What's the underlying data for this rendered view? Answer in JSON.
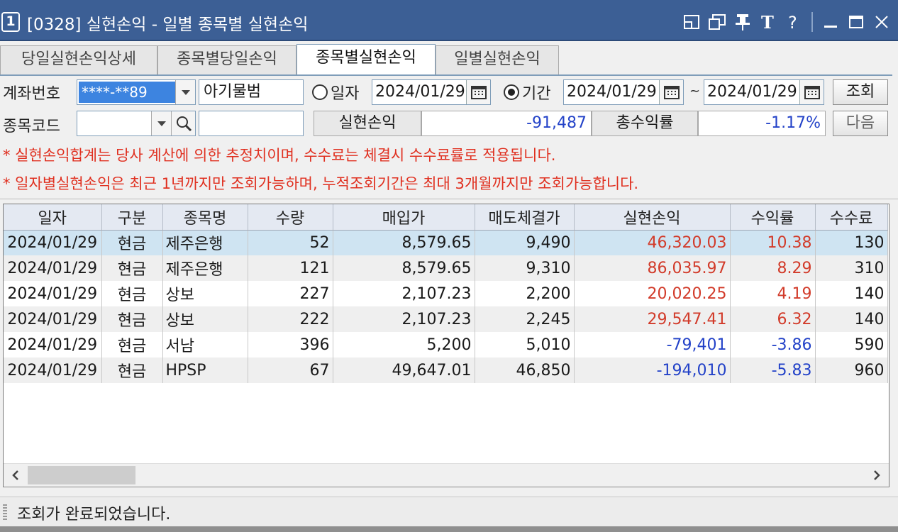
{
  "window": {
    "number": "1",
    "title": "[0328] 실현손익 - 일별 종목별 실현손익"
  },
  "tabs": [
    {
      "label": "당일실현손익상세"
    },
    {
      "label": "종목별당일손익"
    },
    {
      "label": "종목별실현손익"
    },
    {
      "label": "일별실현손익"
    }
  ],
  "form": {
    "account_label": "계좌번호",
    "account_value": "****-**89",
    "account_name": "아기물범",
    "single_date_label": "일자",
    "single_date": "2024/01/29",
    "period_label": "기간",
    "period_from": "2024/01/29",
    "tilde": "~",
    "period_to": "2024/01/29",
    "query_button": "조회",
    "stock_code_label": "종목코드",
    "stock_code_value": "",
    "stock_name_value": "",
    "realized_label": "실현손익",
    "realized_value": "-91,487",
    "total_return_label": "총수익률",
    "total_return_value": "-1.17%",
    "next_button": "다음"
  },
  "notices": [
    "* 실현손익합계는 당사 계산에 의한 추정치이며, 수수료는 체결시 수수료률로 적용됩니다.",
    "* 일자별실현손익은 최근 1년까지만 조회가능하며, 누적조회기간은 최대 3개월까지만 조회가능합니다."
  ],
  "table": {
    "columns": [
      "일자",
      "구분",
      "종목명",
      "수량",
      "매입가",
      "매도체결가",
      "실현손익",
      "수익률",
      "수수료"
    ],
    "rows": [
      [
        "2024/01/29",
        "현금",
        "제주은행",
        "52",
        "8,579.65",
        "9,490",
        "46,320.03",
        "10.38",
        "130"
      ],
      [
        "2024/01/29",
        "현금",
        "제주은행",
        "121",
        "8,579.65",
        "9,310",
        "86,035.97",
        "8.29",
        "310"
      ],
      [
        "2024/01/29",
        "현금",
        "상보",
        "227",
        "2,107.23",
        "2,200",
        "20,020.25",
        "4.19",
        "140"
      ],
      [
        "2024/01/29",
        "현금",
        "상보",
        "222",
        "2,107.23",
        "2,245",
        "29,547.41",
        "6.32",
        "140"
      ],
      [
        "2024/01/29",
        "현금",
        "서남",
        "396",
        "5,200",
        "5,010",
        "-79,401",
        "-3.86",
        "590"
      ],
      [
        "2024/01/29",
        "현금",
        "HPSP",
        "67",
        "49,647.01",
        "46,850",
        "-194,010",
        "-5.83",
        "960"
      ]
    ]
  },
  "status": {
    "message": "조회가 완료되었습니다."
  },
  "colors": {
    "titlebar": "#3c5f95",
    "positive": "#d23b2a",
    "negative": "#2342c8",
    "notice": "#e03020",
    "selected_row": "#cfe4f2"
  }
}
